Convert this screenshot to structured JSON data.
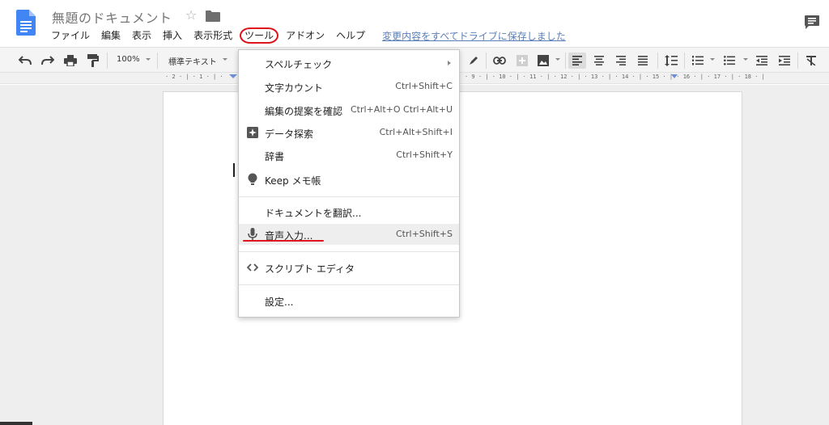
{
  "header": {
    "doc_title": "無題のドキュメント",
    "star_glyph": "☆",
    "save_status": "変更内容をすべてドライブに保存しました"
  },
  "menubar": {
    "items": [
      {
        "label": "ファイル"
      },
      {
        "label": "編集"
      },
      {
        "label": "表示"
      },
      {
        "label": "挿入"
      },
      {
        "label": "表示形式"
      },
      {
        "label": "ツール"
      },
      {
        "label": "アドオン"
      },
      {
        "label": "ヘルプ"
      }
    ],
    "active_item": "ツール"
  },
  "toolbar": {
    "zoom": "100%",
    "style": "標準テキスト"
  },
  "ruler": {
    "left_text": "· 2 · | · 1 · | ·",
    "right_text": "· 9 · | · 10 · | · 11 · | · 12 · | · 13 · | · 14 · | · 15 · | · 16 · | · 17 · | · 18 · |"
  },
  "tools_menu": {
    "items": [
      {
        "label": "スペルチェック",
        "shortcut": "",
        "submenu": true
      },
      {
        "label": "文字カウント",
        "shortcut": "Ctrl+Shift+C"
      },
      {
        "label": "編集の提案を確認",
        "shortcut": "Ctrl+Alt+O Ctrl+Alt+U"
      },
      {
        "label": "データ探索",
        "shortcut": "Ctrl+Alt+Shift+I",
        "icon": "explore-icon"
      },
      {
        "label": "辞書",
        "shortcut": "Ctrl+Shift+Y"
      },
      {
        "label": "Keep メモ帳",
        "shortcut": "",
        "icon": "lightbulb-icon"
      },
      {
        "label": "ドキュメントを翻訳...",
        "shortcut": ""
      },
      {
        "label": "音声入力...",
        "shortcut": "Ctrl+Shift+S",
        "icon": "microphone-icon",
        "highlighted": true
      },
      {
        "label": "スクリプト エディタ",
        "shortcut": "",
        "icon": "code-icon"
      },
      {
        "label": "設定...",
        "shortcut": ""
      }
    ]
  },
  "colors": {
    "accent_red": "#e0141c",
    "docs_blue": "#4285f4",
    "link_blue": "#5a7fb8"
  }
}
